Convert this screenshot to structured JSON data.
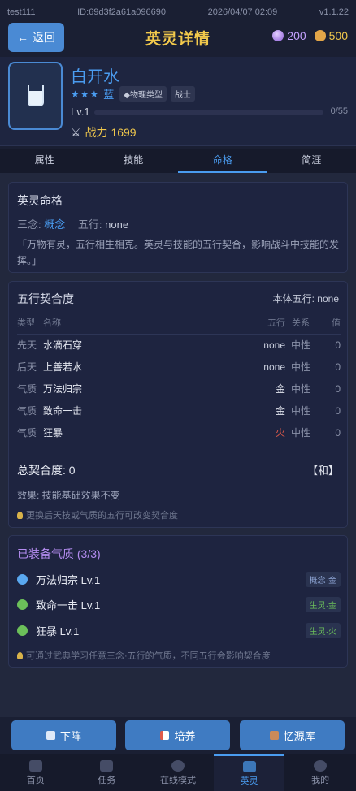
{
  "status": {
    "user": "test111",
    "id": "ID:69d3f2a61a096690",
    "datetime": "2026/04/07 02:09",
    "version": "v1.1.22"
  },
  "header": {
    "back_label": "返回",
    "title": "英灵详情",
    "gems": "200",
    "gold": "500",
    "gem_icon": "gem-icon",
    "gold_icon": "money-bag-icon"
  },
  "hero": {
    "name": "白开水",
    "stars": "★★★",
    "rarity": "蓝",
    "type_tag": "◆物理类型",
    "class_tag": "战士",
    "level": "Lv.1",
    "xp": "0/55",
    "xp_fraction": 0,
    "power": "战力 1699"
  },
  "tabs": [
    "属性",
    "技能",
    "命格",
    "简涯"
  ],
  "fate": {
    "title": "英灵命格",
    "sannian_label": "三念:",
    "sannian_value": "概念",
    "wuxing_label": "五行:",
    "wuxing_value": "none",
    "quote": "「万物有灵，五行相生相克。英灵与技能的五行契合，影响战斗中技能的发挥。」"
  },
  "affinity": {
    "title": "五行契合度",
    "self_element": "本体五行: none",
    "headers": {
      "type": "类型",
      "name": "名称",
      "element": "五行",
      "relation": "关系",
      "value": "值"
    },
    "rows": [
      {
        "type": "先天",
        "name": "水滴石穿",
        "element": "none",
        "relation": "中性",
        "value": "0"
      },
      {
        "type": "后天",
        "name": "上善若水",
        "element": "none",
        "relation": "中性",
        "value": "0"
      },
      {
        "type": "气质",
        "name": "万法归宗",
        "element": "金",
        "relation": "中性",
        "value": "0"
      },
      {
        "type": "气质",
        "name": "致命一击",
        "element": "金",
        "relation": "中性",
        "value": "0"
      },
      {
        "type": "气质",
        "name": "狂暴",
        "element": "火",
        "relation": "中性",
        "value": "0"
      }
    ],
    "total_label": "总契合度: 0",
    "total_rank": "【和】",
    "effect": "效果: 技能基础效果不变",
    "hint": "更换后天技或气质的五行可改变契合度"
  },
  "traits": {
    "title": "已装备气质 (3/3)",
    "items": [
      {
        "name": "万法归宗 Lv.1",
        "tag": "概念·金",
        "dot_color": "#5aa8f0",
        "tag_color": "#8fa6d6"
      },
      {
        "name": "致命一击 Lv.1",
        "tag": "生灵·金",
        "dot_color": "#6cc05a",
        "tag_color": "#6cc05a"
      },
      {
        "name": "狂暴 Lv.1",
        "tag": "生灵·火",
        "dot_color": "#6cc05a",
        "tag_color": "#6cc05a"
      }
    ],
    "hint": "可通过武典学习任意三念·五行的气质，不同五行会影响契合度"
  },
  "actions": [
    {
      "label": "下阵",
      "icon": "download-icon"
    },
    {
      "label": "培养",
      "icon": "chart-icon"
    },
    {
      "label": "忆源库",
      "icon": "box-icon"
    }
  ],
  "nav": [
    "首页",
    "任务",
    "在线模式",
    "英灵",
    "我的"
  ],
  "colors": {
    "accent": "#4a9cf0",
    "gold": "#f2c94c",
    "fire": "#e05a4a",
    "metal": "#e4e7f0",
    "purple": "#b48cf0"
  }
}
